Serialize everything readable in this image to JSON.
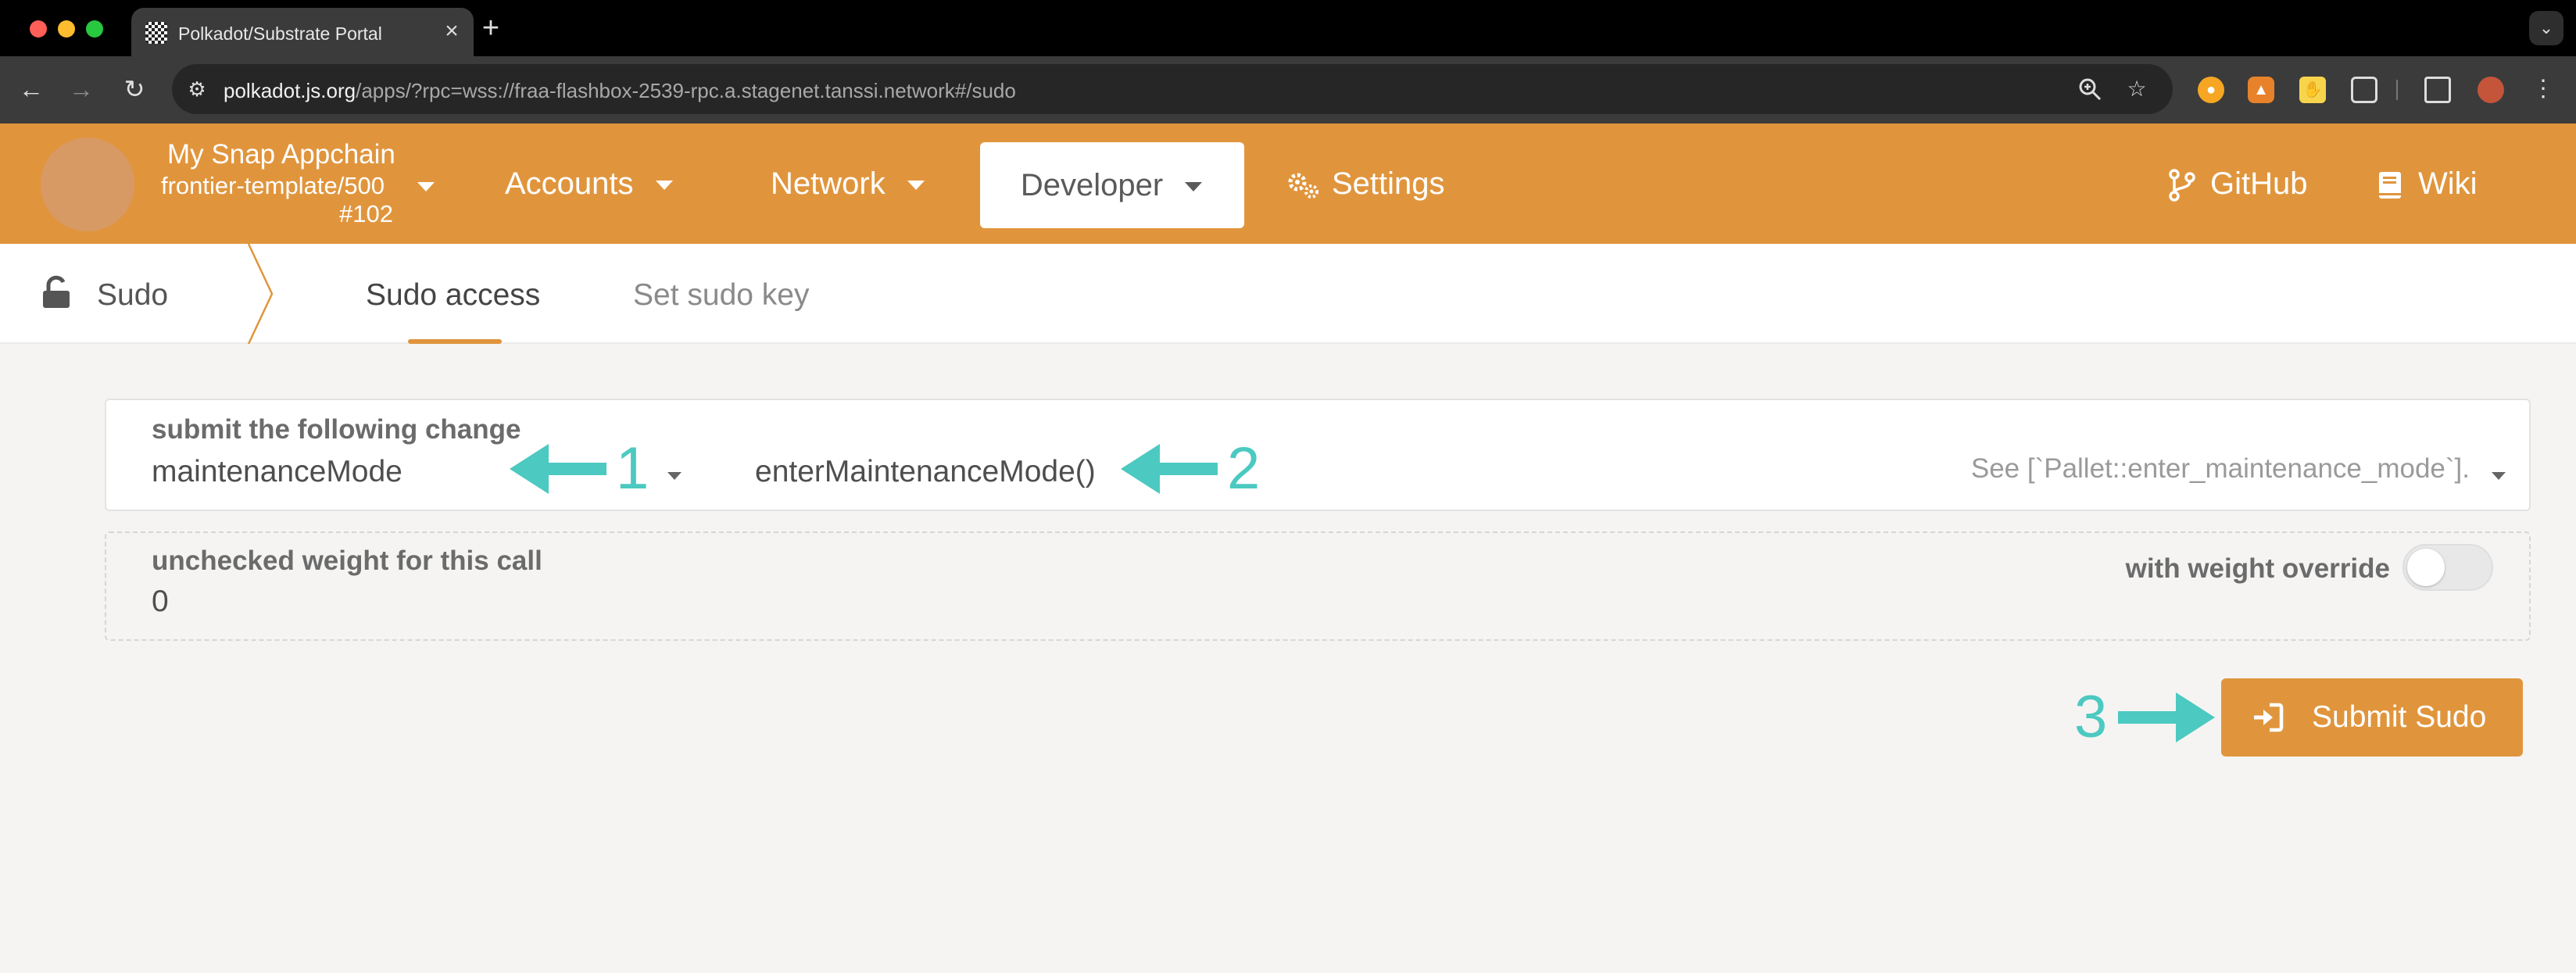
{
  "browser": {
    "tab_title": "Polkadot/Substrate Portal",
    "url_host": "polkadot.js.org",
    "url_path": "/apps/?rpc=wss://fraa-flashbox-2539-rpc.a.stagenet.tanssi.network#/sudo"
  },
  "header": {
    "chain_name": "My Snap Appchain",
    "chain_spec": "frontier-template/500",
    "chain_block": "#102",
    "menu": {
      "accounts": "Accounts",
      "network": "Network",
      "developer": "Developer",
      "settings": "Settings",
      "github": "GitHub",
      "wiki": "Wiki"
    },
    "brand_color": "#e0953d"
  },
  "subnav": {
    "title": "Sudo",
    "tabs": [
      {
        "label": "Sudo access",
        "active": true
      },
      {
        "label": "Set sudo key",
        "active": false
      }
    ]
  },
  "call": {
    "label": "submit the following change",
    "section": "maintenanceMode",
    "method": "enterMaintenanceMode()",
    "doc": "See [`Pallet::enter_maintenance_mode`]."
  },
  "weight": {
    "label": "unchecked weight for this call",
    "value": "0",
    "override_label": "with weight override",
    "override_enabled": false
  },
  "submit": {
    "label": "Submit Sudo"
  },
  "annotations": {
    "arrow_color": "#4cc9c0",
    "labels": [
      "1",
      "2",
      "3"
    ]
  }
}
